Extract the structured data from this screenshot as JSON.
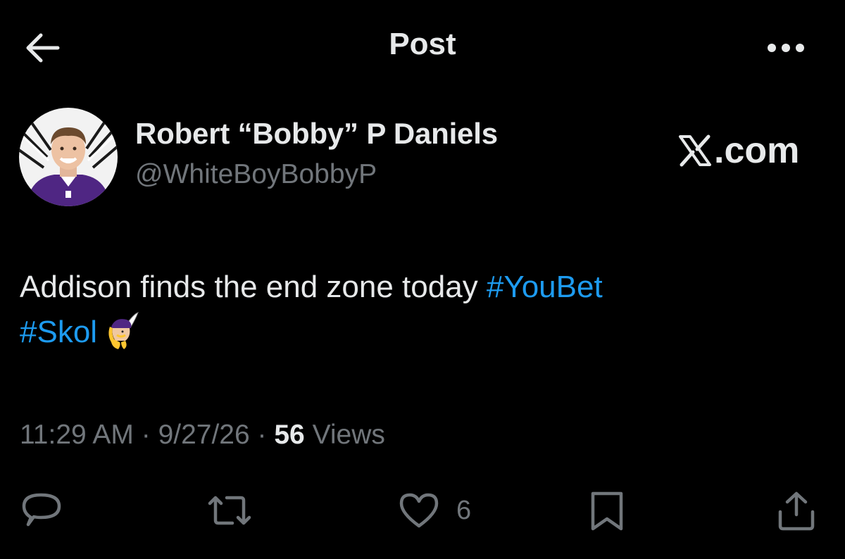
{
  "header": {
    "title": "Post",
    "back_icon": "arrow-left-icon",
    "more_icon": "more-horizontal-icon"
  },
  "author": {
    "name": "Robert “Bobby” P Daniels",
    "handle": "@WhiteBoyBobbyP",
    "avatar_desc": "profile-photo"
  },
  "watermark": {
    "text": ".com",
    "logo": "X"
  },
  "tweet": {
    "text_before": "Addison finds the end zone today ",
    "hashtag_1": "#YouBet",
    "hashtag_2": "#Skol",
    "emoji": "vikings-logo-icon"
  },
  "meta": {
    "time": "11:29 AM",
    "separator": " · ",
    "date": "9/27/26",
    "views_count": "56",
    "views_label": " Views"
  },
  "actions": {
    "reply_icon": "reply-icon",
    "repost_icon": "repost-icon",
    "like_icon": "heart-icon",
    "like_count": "6",
    "bookmark_icon": "bookmark-icon",
    "share_icon": "share-icon"
  },
  "colors": {
    "background": "#000000",
    "text_primary": "#e7e9ea",
    "text_secondary": "#71767b",
    "link": "#1d9bf0",
    "vikings_purple": "#4f2683",
    "vikings_gold": "#ffc62f"
  }
}
